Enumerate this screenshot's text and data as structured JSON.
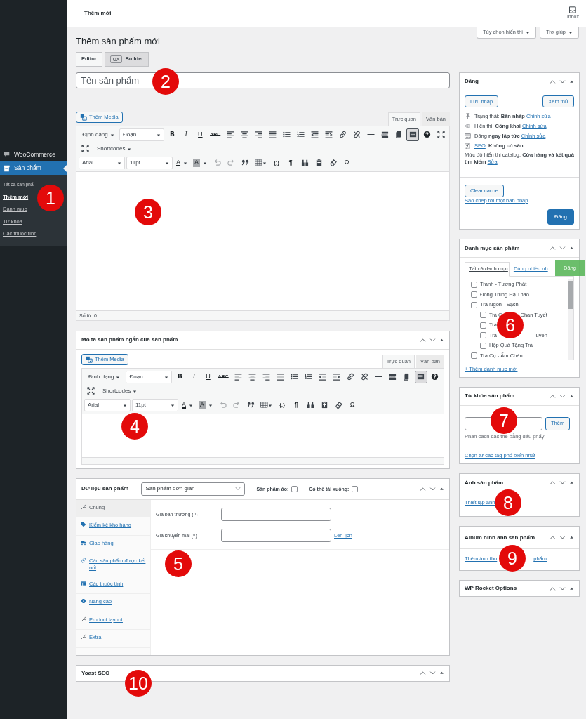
{
  "sidebar": {
    "items": [
      {
        "label": "WooCommerce",
        "kind": "woo",
        "selected": false
      },
      {
        "label": "Sản phẩm",
        "kind": "box",
        "selected": true
      }
    ],
    "submenu": [
      {
        "label": "Tất cả sản phẩ",
        "selected": false
      },
      {
        "label": "Thêm mới",
        "selected": true
      },
      {
        "label": "Danh mục",
        "selected": false
      },
      {
        "label": "Từ khóa",
        "selected": false
      },
      {
        "label": "Các thuộc tính",
        "selected": false
      }
    ]
  },
  "top_bar": {
    "title": "Thêm mới",
    "inbox": "Inbox"
  },
  "page_title": "Thêm sản phẩm mới",
  "screen_buttons": [
    "Tùy chọn hiển thị",
    "Trợ giúp"
  ],
  "editor_tabs": [
    {
      "label": "Editor",
      "selected": true
    },
    {
      "badge": "UX",
      "label": "Builder",
      "selected": false
    }
  ],
  "title_field": {
    "placeholder": "Tên sản phẩm"
  },
  "main_editor": {
    "media_button": "Thêm Media",
    "toggle_pressed": true,
    "mode_tabs": [
      {
        "label": "Trực quan",
        "selected": true
      },
      {
        "label": "Văn bản",
        "selected": false
      }
    ],
    "toolbar": [
      [
        {
          "kind": "menu",
          "text": "Định dạng"
        },
        {
          "kind": "select",
          "text": "Đoạn"
        },
        {
          "kind": "bold",
          "text": "B"
        },
        {
          "kind": "italic",
          "text": "I"
        },
        {
          "kind": "underline",
          "text": "U"
        },
        {
          "kind": "strike",
          "text": "ABC"
        },
        {
          "kind": "align-left"
        },
        {
          "kind": "align-center"
        },
        {
          "kind": "align-right"
        },
        {
          "kind": "justify"
        },
        {
          "kind": "bullets"
        },
        {
          "kind": "numbers"
        },
        {
          "kind": "outdent"
        },
        {
          "kind": "indent"
        },
        {
          "kind": "link"
        },
        {
          "kind": "unlink"
        },
        {
          "kind": "hr"
        },
        {
          "kind": "more"
        },
        {
          "kind": "pages"
        },
        {
          "kind": "toggle"
        },
        {
          "kind": "help"
        },
        {
          "kind": "expand"
        }
      ],
      [
        {
          "kind": "expand"
        },
        {
          "kind": "menu",
          "text": "Shortcodes"
        }
      ],
      [
        {
          "kind": "select",
          "text": "Arial"
        },
        {
          "kind": "select",
          "text": "11pt"
        },
        {
          "kind": "text-color",
          "text": "A"
        },
        {
          "kind": "bg-color",
          "text": "A"
        },
        {
          "kind": "undo"
        },
        {
          "kind": "redo"
        },
        {
          "kind": "quote"
        },
        {
          "kind": "table"
        },
        {
          "kind": "code",
          "text": "{;}"
        },
        {
          "kind": "pilcrow",
          "text": "¶"
        },
        {
          "kind": "find"
        },
        {
          "kind": "paste"
        },
        {
          "kind": "eraser"
        },
        {
          "kind": "omega",
          "text": "Ω"
        }
      ]
    ],
    "word_count": "Số từ: 0"
  },
  "short_description": {
    "title": "Mô tả sản phẩm ngắn của sản phẩm",
    "editor": {
      "media_button": "Thêm Media",
      "toggle_pressed": true,
      "mode_tabs": [
        {
          "label": "Trực quan",
          "selected": true
        },
        {
          "label": "Văn bản",
          "selected": false
        }
      ],
      "toolbar": [
        [
          {
            "kind": "menu",
            "text": "Định dạng"
          },
          {
            "kind": "select",
            "text": "Đoạn"
          },
          {
            "kind": "bold",
            "text": "B"
          },
          {
            "kind": "italic",
            "text": "I"
          },
          {
            "kind": "underline",
            "text": "U"
          },
          {
            "kind": "strike",
            "text": "ABC"
          },
          {
            "kind": "align-left"
          },
          {
            "kind": "align-center"
          },
          {
            "kind": "align-right"
          },
          {
            "kind": "justify"
          },
          {
            "kind": "bullets"
          },
          {
            "kind": "numbers"
          },
          {
            "kind": "outdent"
          },
          {
            "kind": "indent"
          },
          {
            "kind": "link"
          },
          {
            "kind": "unlink"
          },
          {
            "kind": "hr"
          },
          {
            "kind": "more"
          },
          {
            "kind": "pages"
          },
          {
            "kind": "toggle"
          },
          {
            "kind": "help"
          }
        ],
        [
          {
            "kind": "expand"
          },
          {
            "kind": "menu",
            "text": "Shortcodes"
          }
        ],
        [
          {
            "kind": "select",
            "text": "Arial"
          },
          {
            "kind": "select",
            "text": "11pt"
          },
          {
            "kind": "text-color",
            "text": "A"
          },
          {
            "kind": "bg-color",
            "text": "A"
          },
          {
            "kind": "undo"
          },
          {
            "kind": "redo"
          },
          {
            "kind": "quote"
          },
          {
            "kind": "table"
          },
          {
            "kind": "code",
            "text": "{;}"
          },
          {
            "kind": "pilcrow",
            "text": "¶"
          },
          {
            "kind": "find"
          },
          {
            "kind": "paste"
          },
          {
            "kind": "eraser"
          },
          {
            "kind": "omega",
            "text": "Ω"
          }
        ]
      ]
    }
  },
  "product_data": {
    "title": "Dữ liệu sản phẩm —",
    "type_select": "Sản phẩm đơn giản",
    "options": [
      {
        "label": "Sản phẩm ảo:",
        "checked": false
      },
      {
        "label": "Có thể tải xuống:",
        "checked": false
      }
    ],
    "tabs": [
      {
        "kind": "wrench",
        "label": "Chung",
        "selected": true
      },
      {
        "kind": "tag",
        "label": "Kiểm kê kho hàng",
        "selected": false
      },
      {
        "kind": "truck",
        "label": "Giao hàng",
        "selected": false
      },
      {
        "kind": "link",
        "label": "Các sản phẩm được kết nối",
        "selected": false
      },
      {
        "kind": "table",
        "label": "Các thuộc tính",
        "selected": false
      },
      {
        "kind": "gear",
        "label": "Nâng cao",
        "selected": false
      },
      {
        "kind": "wrench",
        "label": "Product layout",
        "selected": false
      },
      {
        "kind": "wrench",
        "label": "Extra",
        "selected": false
      }
    ],
    "fields": [
      {
        "label": "Giá bán thường (₫)"
      },
      {
        "label": "Giá khuyến mãi (₫)",
        "link": "Lên lịch"
      }
    ]
  },
  "yoast": {
    "title": "Yoast SEO"
  },
  "publish": {
    "title": "Đăng",
    "save_button": "Lưu nháp",
    "preview_button": "Xem thử",
    "rows": [
      {
        "kind": "pin",
        "text": "Trạng thái: **Bản nháp**",
        "link": "Chỉnh sửa"
      },
      {
        "kind": "eye",
        "text": "Hiển thị: **Công khai**",
        "link": "Chỉnh sửa"
      },
      {
        "kind": "calendar",
        "text": "Đăng **ngay lập tức**",
        "link": "Chỉnh sửa"
      },
      {
        "kind": "yoast",
        "lead_link": "SEO",
        "text": ": **Không có sẵn**"
      },
      {
        "kind": "plain",
        "text": "Mức độ hiển thị catalog: **Cửa hàng và kết quả tìm kiếm**",
        "link": "Sửa"
      }
    ],
    "cache_button": "Clear cache",
    "copy_link": "Sao chép tới một bản nháp",
    "publish_button": "Đăng"
  },
  "categories": {
    "title": "Danh mục sản phẩm",
    "tabs": [
      {
        "label": "Tất cả danh mục",
        "selected": true
      },
      {
        "label": "Dùng nhiều nh",
        "selected": false
      }
    ],
    "floating_button": "Đăng",
    "items": [
      {
        "label": "Tranh - Tượng Phật",
        "checked": false
      },
      {
        "label": "Đông Trùng Hạ Thảo",
        "checked": false
      },
      {
        "label": "Trà Ngon - Sạch",
        "checked": false,
        "children": [
          {
            "label": "Trà C",
            "tail": "Chan Tuyết",
            "checked": false
          },
          {
            "label": "Trà",
            "checked": false
          },
          {
            "label": "Trà",
            "tail": "uyên",
            "checked": false
          },
          {
            "label": "Hộp Quà Tặng Trà",
            "checked": false
          }
        ]
      },
      {
        "label": "Trà Cụ - Ấm Chén",
        "checked": false
      }
    ],
    "add_link": "+ Thêm danh mục mới"
  },
  "tags": {
    "title": "Từ khóa sản phẩm",
    "add_button": "Thêm",
    "hint": "Phân cách các thẻ bằng dấu phẩy",
    "link": "Chọn từ các tag phổ biến nhất"
  },
  "product_image": {
    "title": "Ảnh sản phẩm",
    "link": "Thiết lập ảnh"
  },
  "gallery": {
    "title": "Album hình ảnh sản phẩm",
    "link": "Thêm ảnh thu",
    "link_tail": "phẩm"
  },
  "rocket": {
    "title": "WP Rocket Options"
  },
  "annotations": [
    "1",
    "2",
    "3",
    "4",
    "5",
    "6",
    "7",
    "8",
    "9",
    "10"
  ]
}
